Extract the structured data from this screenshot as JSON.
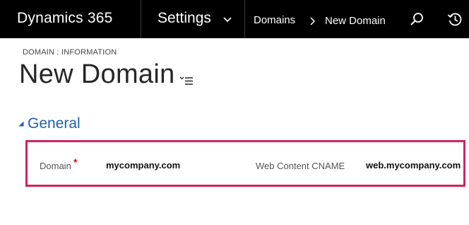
{
  "topbar": {
    "brand": "Dynamics 365",
    "area": "Settings",
    "breadcrumb": [
      "Domains",
      "New Domain"
    ]
  },
  "form": {
    "type_label": "DOMAIN : INFORMATION",
    "title": "New Domain"
  },
  "section": {
    "title": "General",
    "fields": {
      "domain": {
        "label": "Domain",
        "required_marker": "*",
        "value": "mycompany.com"
      },
      "web_content_cname": {
        "label": "Web Content CNAME",
        "value": "web.mycompany.com"
      }
    }
  },
  "colors": {
    "topbar_bg": "#000000",
    "section_title": "#1d5faf",
    "highlight": "#d0245f",
    "required": "#d6081a"
  },
  "icons": {
    "area_menu": "chevron-down-icon",
    "breadcrumb_separator": "chevron-right-icon",
    "search": "search-icon",
    "recent": "history-icon",
    "form_selector": "list-menu-icon",
    "section_collapse": "triangle-expanded-icon"
  }
}
